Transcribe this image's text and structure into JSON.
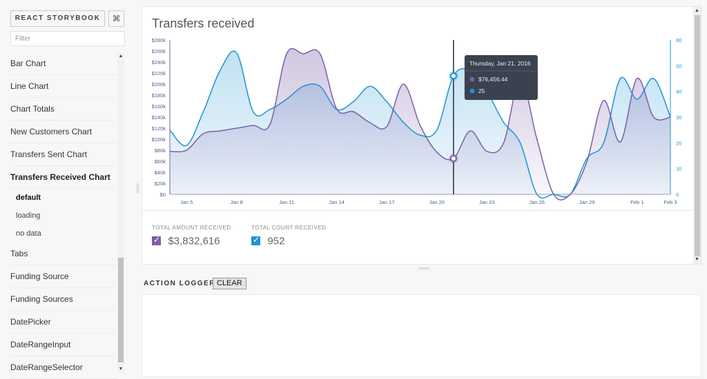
{
  "sidebar": {
    "brand_label": "REACT STORYBOOK",
    "shortcut_icon": "⌘",
    "filter_placeholder": "Filter",
    "items": [
      {
        "label": "Bar Chart"
      },
      {
        "label": "Line Chart"
      },
      {
        "label": "Chart Totals"
      },
      {
        "label": "New Customers Chart"
      },
      {
        "label": "Transfers Sent Chart"
      },
      {
        "label": "Transfers Received Chart",
        "selected": true,
        "stories": [
          {
            "label": "default",
            "selected": true
          },
          {
            "label": "loading"
          },
          {
            "label": "no data"
          }
        ]
      },
      {
        "label": "Tabs"
      },
      {
        "label": "Funding Source"
      },
      {
        "label": "Funding Sources"
      },
      {
        "label": "DatePicker"
      },
      {
        "label": "DateRangeInput"
      },
      {
        "label": "DateRangeSelector"
      }
    ]
  },
  "preview": {
    "title": "Transfers received",
    "tooltip": {
      "date": "Thursday, Jan 21, 2016",
      "amount": "$76,456.44",
      "count": "25"
    },
    "totals": {
      "amount_label": "TOTAL AMOUNT RECEIVED",
      "amount_value": "$3,832,616",
      "count_label": "TOTAL COUNT RECEIVED",
      "count_value": "952"
    }
  },
  "logger": {
    "title": "ACTION LOGGER",
    "clear_label": "CLEAR"
  },
  "colors": {
    "amount": "#7b5ea7",
    "count": "#1e93d2",
    "tooltip_bg": "#3a4250",
    "cursor_line": "#1f2d4d"
  },
  "chart_data": {
    "type": "area",
    "x": [
      "Jan 4",
      "Jan 5",
      "Jan 6",
      "Jan 7",
      "Jan 8",
      "Jan 9",
      "Jan 10",
      "Jan 11",
      "Jan 12",
      "Jan 13",
      "Jan 14",
      "Jan 15",
      "Jan 16",
      "Jan 17",
      "Jan 18",
      "Jan 19",
      "Jan 20",
      "Jan 21",
      "Jan 22",
      "Jan 23",
      "Jan 24",
      "Jan 25",
      "Jan 26",
      "Jan 27",
      "Jan 28",
      "Jan 29",
      "Jan 30",
      "Jan 31",
      "Feb 1",
      "Feb 2",
      "Feb 3"
    ],
    "x_ticks": [
      "Jan 5",
      "Jan 8",
      "Jan 11",
      "Jan 14",
      "Jan 17",
      "Jan 20",
      "Jan 23",
      "Jan 26",
      "Jan 29",
      "Feb 1",
      "Feb 3"
    ],
    "series": [
      {
        "axis": "left",
        "values": [
          78000,
          80000,
          110000,
          115000,
          120000,
          125000,
          127000,
          255000,
          255000,
          255000,
          155000,
          150000,
          130000,
          123000,
          200000,
          125000,
          76456,
          65000,
          115000,
          78000,
          93000,
          210000,
          100000,
          0,
          0,
          60000,
          170000,
          95000,
          210000,
          140000,
          140000
        ]
      },
      {
        "axis": "right",
        "values": [
          25,
          19,
          32,
          48,
          55,
          32,
          33,
          37,
          42,
          42,
          33,
          36,
          42,
          36,
          28,
          23,
          25,
          46,
          48,
          40,
          28,
          20,
          0,
          0,
          0,
          14,
          20,
          45,
          37,
          45,
          30
        ]
      }
    ],
    "y_left": {
      "ticks": [
        "$0",
        "$20k",
        "$40k",
        "$60k",
        "$80k",
        "$100k",
        "$120k",
        "$140k",
        "$160k",
        "$180k",
        "$200k",
        "$220k",
        "$240k",
        "$260k",
        "$280k"
      ],
      "range": [
        0,
        280000
      ]
    },
    "y_right": {
      "ticks": [
        "0",
        "10",
        "20",
        "30",
        "40",
        "50",
        "60"
      ],
      "range": [
        0,
        60
      ]
    },
    "highlight": {
      "x": "Jan 21"
    }
  }
}
